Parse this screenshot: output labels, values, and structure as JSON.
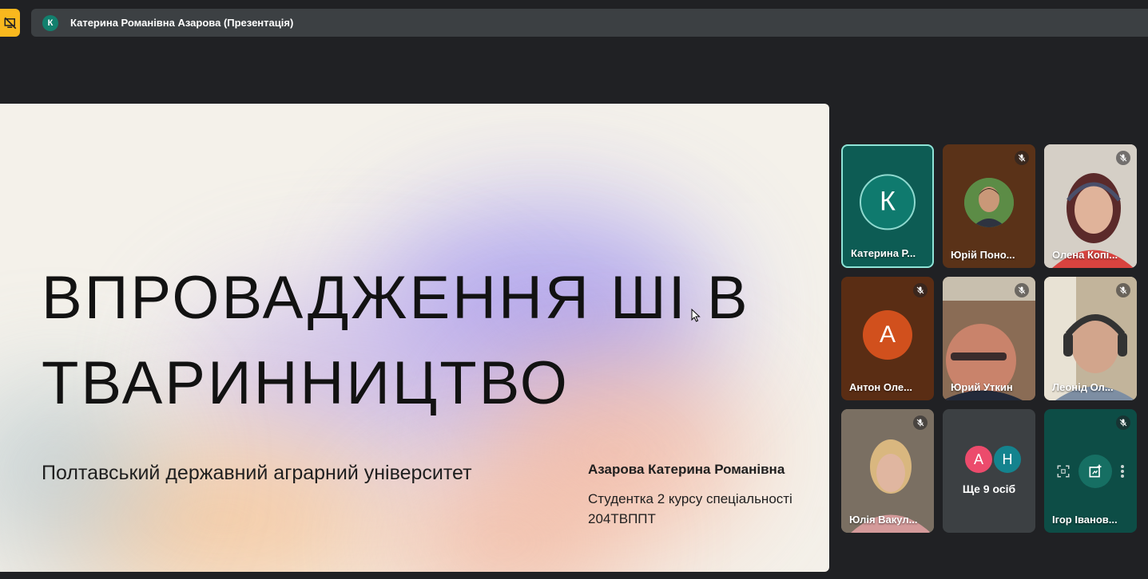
{
  "app": {
    "presenter_badge_letter": "К",
    "presentation_title": "Катерина Романівна Азарова (Презентація)"
  },
  "slide": {
    "heading_line1": "ВПРОВАДЖЕННЯ ШІ В",
    "heading_line2": "ТВАРИННИЦТВО",
    "university": "Полтавський державний аграрний університет",
    "author": "Азарова Катерина Романівна",
    "student_line1": "Студентка 2 курсу спеціальності",
    "student_line2": "204ТВППТ"
  },
  "participants": [
    {
      "name": "Катерина Р...",
      "avatar_letter": "К",
      "muted": false,
      "speaking": true
    },
    {
      "name": "Юрій Поно...",
      "muted": true
    },
    {
      "name": "Олена Копі...",
      "muted": true
    },
    {
      "name": "Антон Оле...",
      "avatar_letter": "А",
      "muted": true
    },
    {
      "name": "Юрий Уткин",
      "muted": true
    },
    {
      "name": "Леонід Ол...",
      "muted": true
    },
    {
      "name": "Юлія Вакул...",
      "muted": true
    },
    {
      "more_label": "Ще 9 осіб",
      "avatar_letters": [
        "А",
        "Н"
      ]
    },
    {
      "name": "Ігор Іванов...",
      "muted": true
    }
  ],
  "colors": {
    "background": "#202124",
    "present_button": "#f9b81e",
    "accent_teal": "#12806e",
    "avatar_a_orange": "#d1501d",
    "more_avatar_pink": "#ec4b6c",
    "more_avatar_teal": "#14838e"
  },
  "icons": {
    "present": "present-to-all-icon",
    "mic_off": "mic-off-icon",
    "cursor": "mouse-cursor-icon",
    "frame": "fullscreen-frame-icon",
    "pin": "pin-icon",
    "more": "more-vert-icon"
  }
}
